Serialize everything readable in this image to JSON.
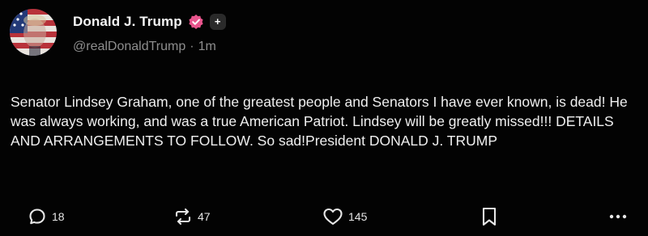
{
  "author": {
    "display_name": "Donald J. Trump",
    "handle": "@realDonaldTrump",
    "separator": "·",
    "timestamp": "1m",
    "verified_icon": "verified-badge-icon",
    "follow_icon": "plus-icon",
    "follow_label": "+"
  },
  "post": {
    "text": "Senator Lindsey Graham, one of the greatest people and Senators I have ever known, is dead! He was always working, and was a true American Patriot. Lindsey will be greatly missed!!! DETAILS AND ARRANGEMENTS TO FOLLOW. So sad!President DONALD J. TRUMP"
  },
  "actions": {
    "reply_count": "18",
    "repost_count": "47",
    "like_count": "145",
    "reply_icon": "reply-icon",
    "repost_icon": "repost-icon",
    "like_icon": "heart-icon",
    "bookmark_icon": "bookmark-icon",
    "more_icon": "more-icon"
  },
  "colors": {
    "background": "#030303",
    "text": "#f0f0f0",
    "muted": "#8e8e8e",
    "verified": "#e8548c"
  }
}
